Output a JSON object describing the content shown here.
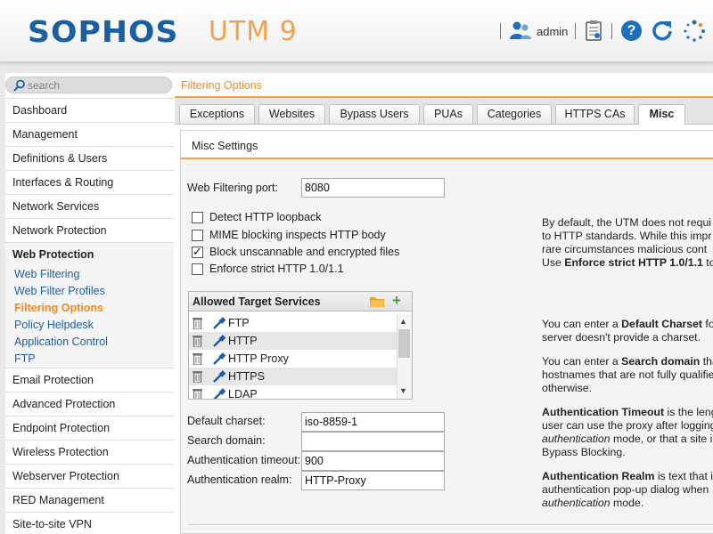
{
  "header": {
    "logo": "SOPHOS",
    "product": "UTM 9",
    "username": "admin",
    "icons": [
      "user-icon",
      "clipboard-icon",
      "help-icon",
      "reload-icon",
      "spinner-icon"
    ]
  },
  "search": {
    "placeholder": "search"
  },
  "sidebar": {
    "items": [
      {
        "label": "Dashboard"
      },
      {
        "label": "Management"
      },
      {
        "label": "Definitions & Users"
      },
      {
        "label": "Interfaces & Routing"
      },
      {
        "label": "Network Services"
      },
      {
        "label": "Network Protection"
      },
      {
        "label": "Web Protection",
        "active": true
      },
      {
        "label": "Email Protection"
      },
      {
        "label": "Advanced Protection"
      },
      {
        "label": "Endpoint Protection"
      },
      {
        "label": "Wireless Protection"
      },
      {
        "label": "Webserver Protection"
      },
      {
        "label": "RED Management"
      },
      {
        "label": "Site-to-site VPN"
      }
    ],
    "subitems": [
      {
        "label": "Web Filtering"
      },
      {
        "label": "Web Filter Profiles"
      },
      {
        "label": "Filtering Options",
        "selected": true
      },
      {
        "label": "Policy Helpdesk"
      },
      {
        "label": "Application Control"
      },
      {
        "label": "FTP"
      }
    ]
  },
  "breadcrumb": "Filtering Options",
  "tabs": [
    {
      "label": "Exceptions"
    },
    {
      "label": "Websites"
    },
    {
      "label": "Bypass Users"
    },
    {
      "label": "PUAs"
    },
    {
      "label": "Categories"
    },
    {
      "label": "HTTPS CAs"
    },
    {
      "label": "Misc",
      "active": true
    }
  ],
  "panel": {
    "title": "Misc Settings",
    "port_label": "Web Filtering port:",
    "port_value": "8080",
    "checkboxes": [
      {
        "label": "Detect HTTP loopback",
        "checked": false
      },
      {
        "label": "MIME blocking inspects HTTP body",
        "checked": false
      },
      {
        "label": "Block unscannable and encrypted files",
        "checked": true
      },
      {
        "label": "Enforce strict HTTP 1.0/1.1",
        "checked": false
      }
    ],
    "services": {
      "title": "Allowed Target Services",
      "items": [
        "FTP",
        "HTTP",
        "HTTP Proxy",
        "HTTPS",
        "LDAP"
      ]
    },
    "charset_label": "Default charset:",
    "charset_value": "iso-8859-1",
    "search_domain_label": "Search domain:",
    "search_domain_value": "",
    "auth_timeout_label": "Authentication timeout:",
    "auth_timeout_value": "900",
    "auth_realm_label": "Authentication realm:",
    "auth_realm_value": "HTTP-Proxy"
  },
  "help": {
    "p1": [
      "By default, the UTM does not requi",
      "to HTTP standards. While this impr",
      "rare circumstances malicious cont"
    ],
    "p1_last_pre": "Use ",
    "p1_last_bold": "Enforce strict HTTP 1.0/1.1",
    "p1_last_post": " to",
    "p2_pre": "You can enter a ",
    "p2_bold": "Default Charset",
    "p2_post": " for",
    "p2_line2": "server doesn't provide a charset.",
    "p3_pre": "You can enter a ",
    "p3_bold": "Search domain",
    "p3_post": " tha",
    "p3_line2": "hostnames that are not fully qualifie",
    "p3_line3": "otherwise.",
    "p4_bold": "Authentication Timeout",
    "p4_post": " is the leng",
    "p4_line2": "user can use the proxy after logging",
    "p4_line3_italic": "authentication",
    "p4_line3_post": " mode, or that a site i",
    "p4_line4": "Bypass Blocking.",
    "p5_bold": "Authentication Realm",
    "p5_post": " is text that is",
    "p5_line2": "authentication pop-up dialog when",
    "p5_line3_italic": "authentication",
    "p5_line3_post": " mode."
  },
  "colors": {
    "brand_blue": "#1b5fa3",
    "accent_orange": "#f08a1e",
    "link_blue": "#1c5ea8"
  }
}
